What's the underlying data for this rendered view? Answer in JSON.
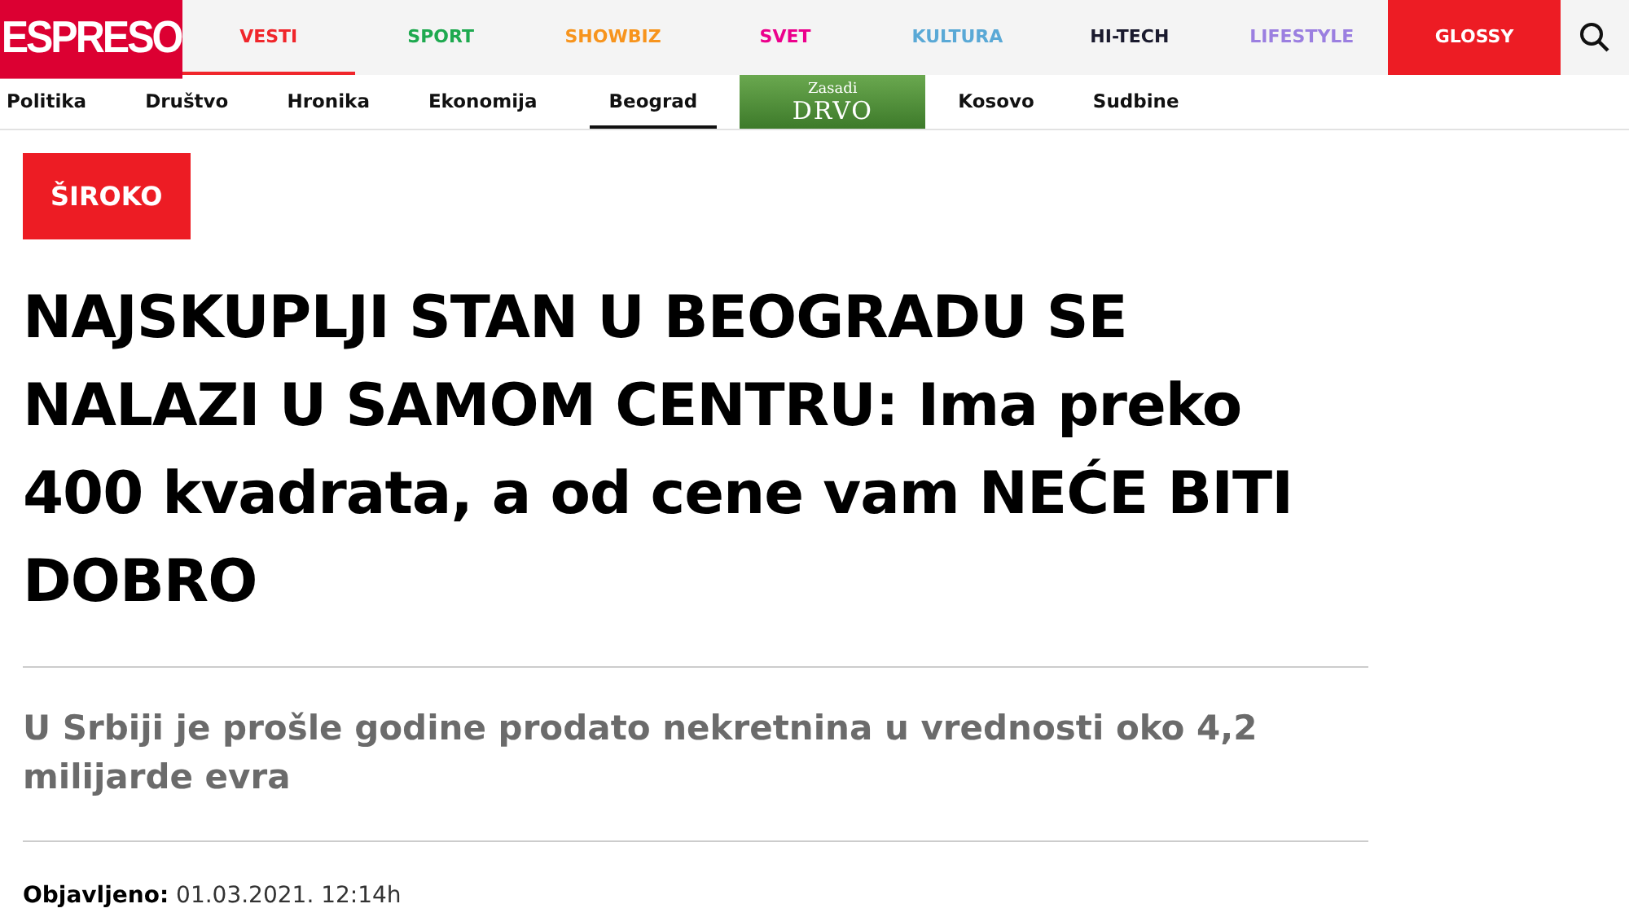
{
  "logo": "ESPRESO",
  "nav": [
    {
      "label": "VESTI",
      "color": "#f0262b",
      "selected": true,
      "kind": "link"
    },
    {
      "label": "SPORT",
      "color": "#1ea94f",
      "selected": false,
      "kind": "link"
    },
    {
      "label": "SHOWBIZ",
      "color": "#f7941d",
      "selected": false,
      "kind": "link"
    },
    {
      "label": "SVET",
      "color": "#ec008c",
      "selected": false,
      "kind": "link"
    },
    {
      "label": "KULTURA",
      "color": "#5aa9d6",
      "selected": false,
      "kind": "link"
    },
    {
      "label": "HI-TECH",
      "color": "#1a1a2e",
      "selected": false,
      "kind": "link"
    },
    {
      "label": "LIFESTYLE",
      "color": "#9b7fe0",
      "selected": false,
      "kind": "link"
    },
    {
      "label": "GLOSSY",
      "color": "#ed1c24",
      "selected": false,
      "kind": "highlight"
    }
  ],
  "subnav": [
    {
      "kind": "link",
      "label": "Politika",
      "selected": false
    },
    {
      "kind": "link",
      "label": "Društvo",
      "selected": false
    },
    {
      "kind": "link",
      "label": "Hronika",
      "selected": false
    },
    {
      "kind": "link",
      "label": "Ekonomija",
      "selected": false
    },
    {
      "kind": "link",
      "label": "Beograd",
      "selected": true
    },
    {
      "kind": "banner",
      "label": "Zasadi",
      "label2": "DRVO",
      "selected": false
    },
    {
      "kind": "link",
      "label": "Kosovo",
      "selected": false
    },
    {
      "kind": "link",
      "label": "Sudbine",
      "selected": false
    }
  ],
  "article": {
    "tag": "ŠIROKO",
    "title": "NAJSKUPLJI STAN U BEOGRADU SE NALAZI U SAMOM CENTRU: Ima preko 400 kvadrata, a od cene vam NEĆE BITI DOBRO",
    "lead": "U Srbiji je prošle godine prodato nekretnina u vrednosti oko 4,2 milijarde evra",
    "published_label": "Objavljeno:",
    "published": "01.03.2021. 12:14h"
  }
}
